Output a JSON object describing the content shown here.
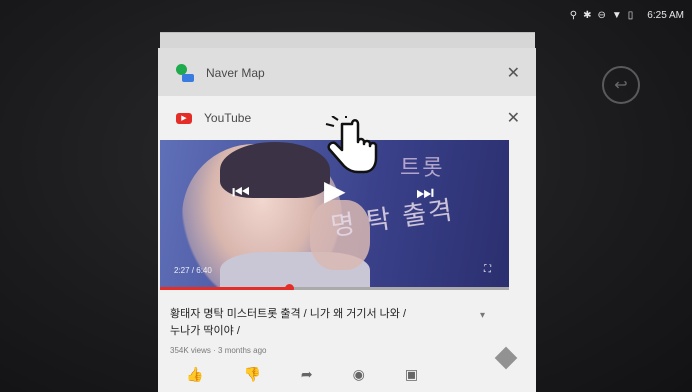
{
  "status_bar": {
    "icons": [
      "location-icon",
      "bluetooth-icon",
      "dnd-icon",
      "wifi-icon",
      "battery-icon"
    ],
    "time": "6:25 AM"
  },
  "recents": {
    "back_button_icon": "back-arrow-icon",
    "cards": [
      {
        "app": "Naver Map",
        "icon": "naver-map-icon"
      },
      {
        "app": "YouTube",
        "icon": "youtube-icon"
      }
    ]
  },
  "video": {
    "time": "2:27 / 6:40",
    "progress_fraction": 0.37,
    "title_line1": "황태자 명탁 미스터트롯 출격 / 니가 왜 거기서 나와 /",
    "title_line2": "누나가 딱이야 /",
    "meta": "354K views · 3 months ago",
    "overlay_text": [
      "트롯",
      "명 탁 출격"
    ]
  },
  "colors": {
    "accent": "#e52d27",
    "card_bg": "#f1f1f1"
  }
}
